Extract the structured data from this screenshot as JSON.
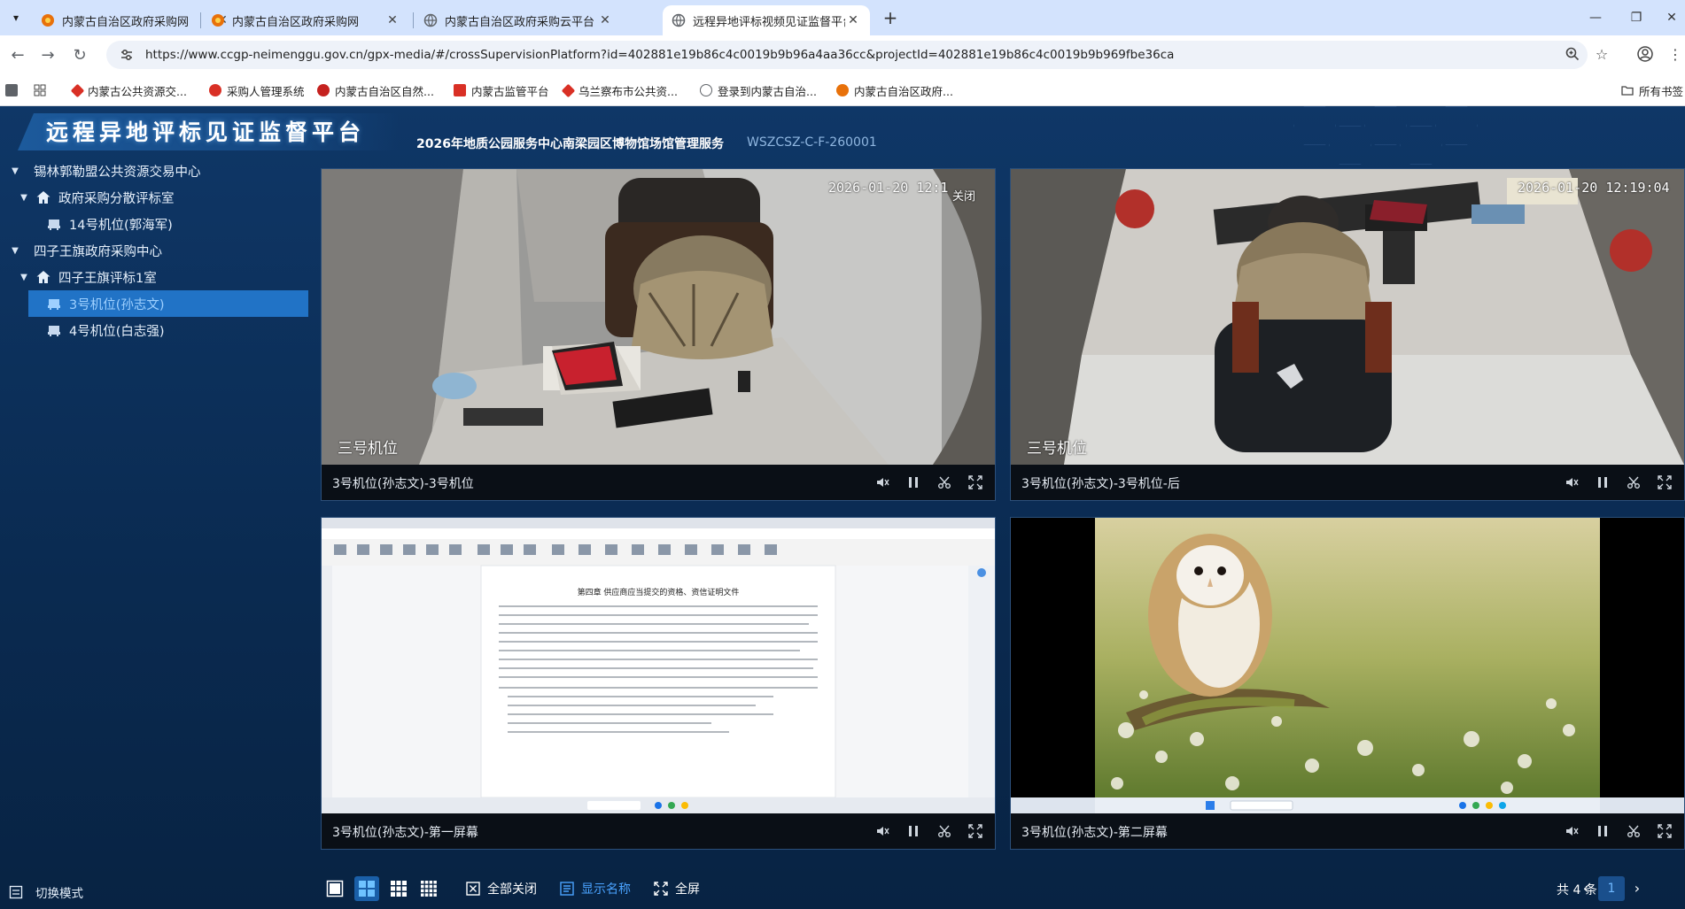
{
  "browser": {
    "tabs": [
      {
        "title": "内蒙古自治区政府采购网",
        "active": false
      },
      {
        "title": "内蒙古自治区政府采购网",
        "active": false
      },
      {
        "title": "内蒙古自治区政府采购云平台",
        "active": false
      },
      {
        "title": "远程异地评标视频见证监督平台",
        "active": true
      }
    ],
    "url": "https://www.ccgp-neimenggu.gov.cn/gpx-media/#/crossSupervisionPlatform?id=402881e19b86c4c0019b9b96a4aa36cc&projectId=402881e19b86c4c0019b9b969fbe36ca",
    "bookmarks": [
      {
        "label": "内蒙古公共资源交...",
        "color": "#d93025"
      },
      {
        "label": "采购人管理系统",
        "color": "#d93025"
      },
      {
        "label": "内蒙古自治区自然...",
        "color": "#c5221f"
      },
      {
        "label": "内蒙古监管平台",
        "color": "#d93025"
      },
      {
        "label": "乌兰察布市公共资...",
        "color": "#d93025"
      },
      {
        "label": "登录到内蒙古自治...",
        "color": "#5f6368"
      },
      {
        "label": "内蒙古自治区政府...",
        "color": "#e8710a"
      }
    ],
    "all_bookmarks": "所有书签"
  },
  "app": {
    "title": "远程异地评标见证监督平台",
    "project_name": "2026年地质公园服务中心南梁园区博物馆场馆管理服务",
    "project_code": "WSZCSZ-C-F-260001"
  },
  "tree": [
    {
      "label": "锡林郭勒盟公共资源交易中心",
      "level": 0,
      "type": "org",
      "expanded": true
    },
    {
      "label": "政府采购分散评标室",
      "level": 1,
      "type": "room",
      "expanded": true
    },
    {
      "label": "14号机位(郭海军)",
      "level": 2,
      "type": "seat"
    },
    {
      "label": "四子王旗政府采购中心",
      "level": 0,
      "type": "org",
      "expanded": true
    },
    {
      "label": "四子王旗评标1室",
      "level": 1,
      "type": "room",
      "expanded": true
    },
    {
      "label": "3号机位(孙志文)",
      "level": 2,
      "type": "seat",
      "selected": true
    },
    {
      "label": "4号机位(白志强)",
      "level": 2,
      "type": "seat"
    }
  ],
  "videos": [
    {
      "label": "3号机位(孙志文)-3号机位",
      "osd_time": "2026-01-20 12:1",
      "osd_cam": "三号机位",
      "osd_close": "关闭"
    },
    {
      "label": "3号机位(孙志文)-3号机位-后",
      "osd_time": "2026-01-20 12:19:04",
      "osd_cam": "三号机位"
    },
    {
      "label": "3号机位(孙志文)-第一屏幕",
      "doc_heading": "第四章 供应商应当提交的资格、资信证明文件"
    },
    {
      "label": "3号机位(孙志文)-第二屏幕"
    }
  ],
  "bottom": {
    "close_all": "全部关闭",
    "show_name": "显示名称",
    "fullscreen": "全屏",
    "total": "共 4 条",
    "page": "1",
    "switch_mode": "切换模式"
  },
  "colors": {
    "accent": "#2173c6",
    "highlight_text": "#4aa3ff",
    "app_bg": "#0f3767"
  }
}
